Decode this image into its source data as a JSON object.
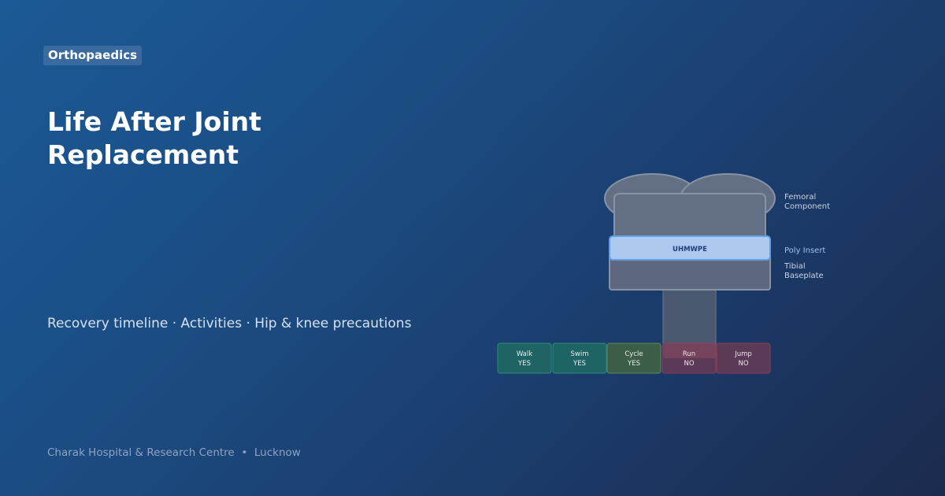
{
  "header": {
    "badge": "Orthopaedics",
    "title_line1": "Life After Joint",
    "title_line2": "Replacement",
    "subtitle": "Recovery timeline · Activities · Hip & knee precautions"
  },
  "footer": {
    "hospital": "Charak Hospital & Research Centre",
    "separator": "•",
    "city": "Lucknow"
  },
  "implant": {
    "femoral_label_line1": "Femoral",
    "femoral_label_line2": "Component",
    "insert_text": "UHMWPE",
    "poly_label": "Poly Insert",
    "tibial_label_line1": "Tibial",
    "tibial_label_line2": "Baseplate"
  },
  "activities": [
    {
      "name": "Walk",
      "status": "YES"
    },
    {
      "name": "Swim",
      "status": "YES"
    },
    {
      "name": "Cycle",
      "status": "YES"
    },
    {
      "name": "Run",
      "status": "NO"
    },
    {
      "name": "Jump",
      "status": "NO"
    }
  ],
  "colors": {
    "yes_teal": "#1f6464",
    "cycle_green": "#3c5e48",
    "no_red": "#5b3a58",
    "insert_blue": "#adc9f0"
  }
}
